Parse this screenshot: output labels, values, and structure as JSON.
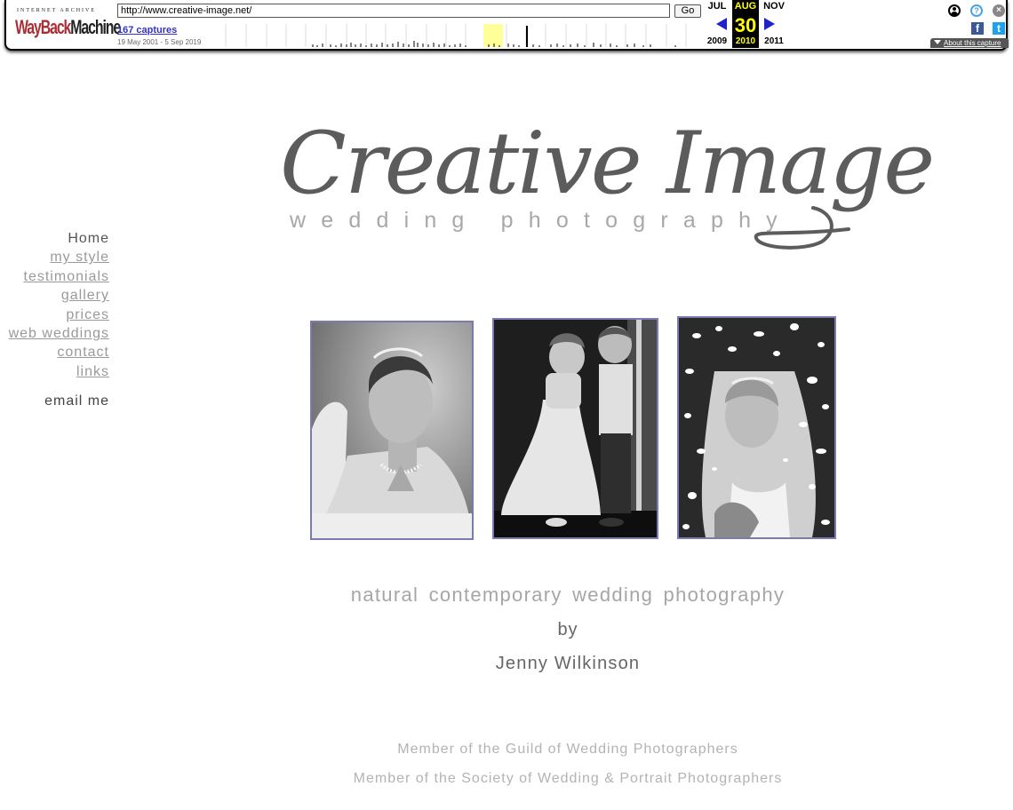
{
  "wayback": {
    "logo_top": "INTERNET ARCHIVE",
    "logo_way": "WayBack",
    "logo_machine": "Machine",
    "url_value": "http://www.creative-image.net/",
    "go_label": "Go",
    "captures_link": "167 captures",
    "capture_range": "19 May 2001 - 5 Sep 2019",
    "months": {
      "prev": "JUL",
      "current": "AUG",
      "next": "NOV"
    },
    "day": "30",
    "years": {
      "prev": "2009",
      "current": "2010",
      "next": "2011"
    },
    "about_label": "About this capture",
    "help_glyph": "?",
    "close_glyph": "×",
    "fb_glyph": "f",
    "tw_glyph": "t",
    "colors": {
      "brand_red": "#ab2e33",
      "link_blue": "#3333cc",
      "highlight": "#ffff00"
    }
  },
  "site": {
    "logo_script": "Creative Image",
    "logo_subtitle": "wedding photography",
    "nav": [
      {
        "label": "Home",
        "current": true
      },
      {
        "label": "my style"
      },
      {
        "label": "testimonials"
      },
      {
        "label": "gallery"
      },
      {
        "label": "prices"
      },
      {
        "label": "web weddings"
      },
      {
        "label": "contact"
      },
      {
        "label": "links"
      }
    ],
    "email_label": "email me",
    "tagline": "natural contemporary wedding photography",
    "by": "by",
    "author": "Jenny Wilkinson",
    "member_1": "Member of the Guild of Wedding Photographers",
    "member_2": "Member of the Society of Wedding & Portrait Photographers",
    "colors": {
      "photo_border": "#7c7ab2",
      "logo_dark": "#5c5c5c",
      "nav_gray": "#9a9a9a"
    }
  }
}
